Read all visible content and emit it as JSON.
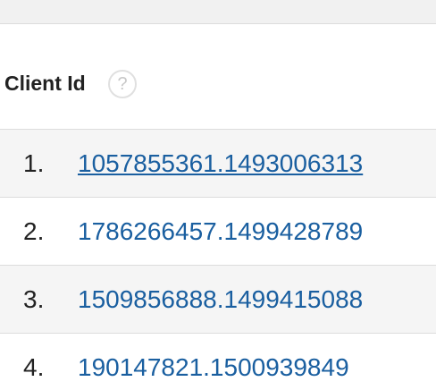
{
  "table": {
    "column_header": "Client Id",
    "help_icon": "question-mark-help-icon",
    "help_glyph": "?",
    "rows": [
      {
        "number": "1.",
        "client_id": "1057855361.1493006313"
      },
      {
        "number": "2.",
        "client_id": "1786266457.1499428789"
      },
      {
        "number": "3.",
        "client_id": "1509856888.1499415088"
      },
      {
        "number": "4.",
        "client_id": "190147821.1500939849"
      }
    ]
  },
  "colors": {
    "link": "#1a5fa0",
    "text": "#222222",
    "row_shade": "#f5f5f5",
    "divider": "#dcdcdc"
  }
}
